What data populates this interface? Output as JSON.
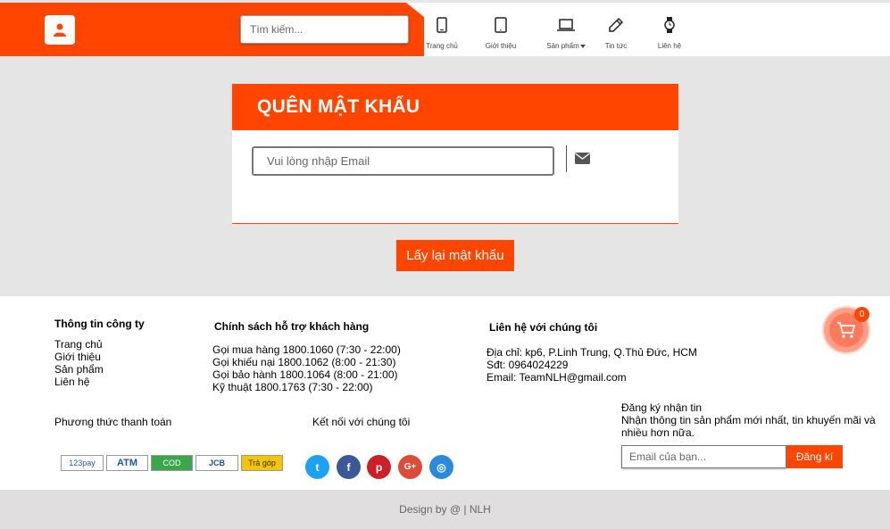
{
  "header": {
    "search_placeholder": "Tìm kiếm...",
    "nav": [
      {
        "label": "Trang chủ",
        "icon": "smartphone-icon"
      },
      {
        "label": "Giới thiệu",
        "icon": "tablet-icon"
      },
      {
        "label": "Sản phẩm",
        "icon": "laptop-icon"
      },
      {
        "label": "Tin tức",
        "icon": "pen-icon"
      },
      {
        "label": "Liên hệ",
        "icon": "watch-icon"
      }
    ],
    "accent_color": "#ff4500"
  },
  "form": {
    "title": "QUÊN MẬT KHẨU",
    "email_placeholder": "Vui lòng nhập Email",
    "submit_label": "Lấy lại mật khẩu"
  },
  "footer": {
    "company": {
      "title": "Thông tin công ty",
      "links": [
        "Trang chủ",
        "Giới thiệu",
        "Sản phẩm",
        "Liên hệ"
      ]
    },
    "policy": {
      "title": "Chính sách hỗ trợ khách hàng",
      "lines": [
        "Gọi mua hàng 1800.1060 (7:30 - 22:00)",
        "Gọi khiếu nại 1800.1062 (8:00 - 21:30)",
        "Gọi bảo hành 1800.1064 (8:00 - 21:00)",
        "Kỹ thuật 1800.1763 (7:30 - 22:00)"
      ]
    },
    "contact": {
      "title": "Liên hệ với chúng tôi",
      "lines": [
        "Địa chỉ: kp6, P.Linh Trung, Q.Thủ Đức, HCM",
        "Sđt: 0964024229",
        "Email: TeamNLH@gmail.com"
      ]
    },
    "payment": {
      "title": "Phương thức thanh toán",
      "methods": [
        "123pay",
        "ATM",
        "COD",
        "JCB",
        "Trả góp"
      ]
    },
    "social": {
      "title": "Kết nối với chúng tôi",
      "items": [
        {
          "name": "twitter-icon",
          "glyph": "t",
          "color": "#1da1f2"
        },
        {
          "name": "facebook-icon",
          "glyph": "f",
          "color": "#3b5998"
        },
        {
          "name": "pinterest-icon",
          "glyph": "p",
          "color": "#cb2027"
        },
        {
          "name": "google-plus-icon",
          "glyph": "G+",
          "color": "#dd4b39"
        },
        {
          "name": "instagram-icon",
          "glyph": "◎",
          "color": "#2a8bdd"
        }
      ]
    },
    "newsletter": {
      "title": "Đăng ký nhận tin",
      "desc": "Nhận thông tin sản phẩm mới nhất, tin khuyến mãi và nhiều hơn nữa.",
      "placeholder": "Email của bạn...",
      "button": "Đăng kí"
    },
    "cart_count": "0",
    "copyright": "Design by @ | NLH"
  }
}
